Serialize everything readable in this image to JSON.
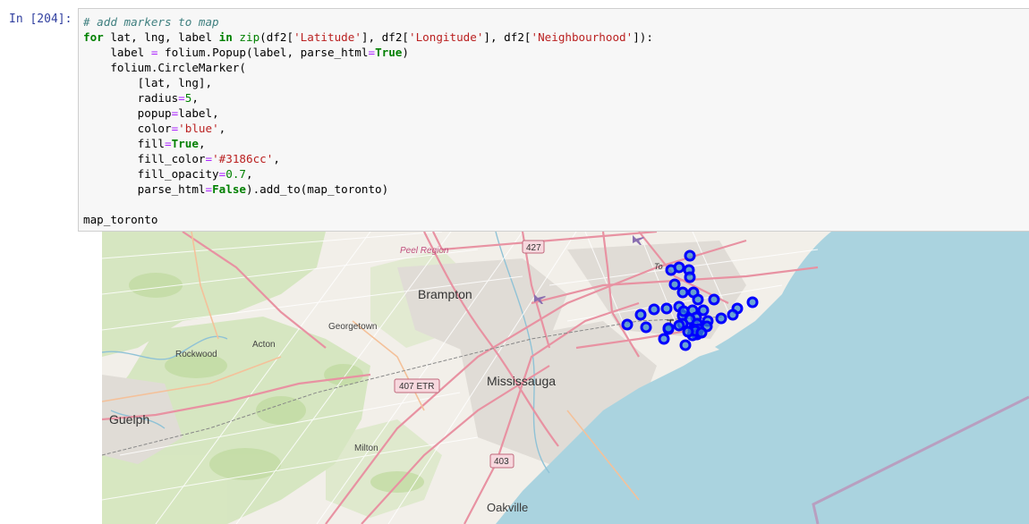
{
  "cell": {
    "prompt": "In [204]:",
    "code": {
      "comment": "# add markers to map",
      "for_kw": "for",
      "loop_vars": " lat, lng, label ",
      "in_kw": "in",
      "zip_fn": "zip",
      "zip_open": "(df2[",
      "col_lat": "'Latitude'",
      "sep1": "], df2[",
      "col_lng": "'Longitude'",
      "sep2": "], df2[",
      "col_nb": "'Neighbourhood'",
      "zip_close": "]):",
      "popup_prefix": "    label ",
      "eq": "=",
      "popup_call": " folium.Popup(label, parse_html",
      "true_kw": "True",
      "close_paren": ")",
      "circle_call": "    folium.CircleMarker(",
      "arg_latlng": "        [lat, lng],",
      "arg_radius_name": "        radius",
      "arg_radius_val": "5",
      "arg_popup_name": "        popup",
      "arg_popup_val": "label,",
      "arg_color_name": "        color",
      "arg_color_val": "'blue'",
      "arg_fill_name": "        fill",
      "arg_fillcolor_name": "        fill_color",
      "arg_fillcolor_val": "'#3186cc'",
      "arg_fillop_name": "        fill_opacity",
      "arg_fillop_val": "0.7",
      "arg_parse_name": "        parse_html",
      "false_kw": "False",
      "add_to": ").add_to(map_toronto)",
      "comma": ",",
      "output_var": "map_toronto"
    }
  },
  "map": {
    "labels": {
      "peel_region": "Peel Region",
      "brampton": "Brampton",
      "georgetown": "Georgetown",
      "acton": "Acton",
      "rockwood": "Rockwood",
      "mississauga": "Mississauga",
      "guelph": "Guelph",
      "milton": "Milton",
      "oakville": "Oakville",
      "toronto_partial": "To",
      "toronto_t": "T"
    },
    "shields": {
      "hwy_427": "427",
      "hwy_407": "407 ETR",
      "hwy_403": "403"
    },
    "colors": {
      "land": "#f2efe9",
      "water": "#aad3df",
      "park": "#cde2b4",
      "major_road": "#e892a2",
      "minor_road": "#ffffff",
      "marker_stroke": "#0000ff",
      "marker_fill": "#3186cc"
    },
    "marker_count": 42
  }
}
